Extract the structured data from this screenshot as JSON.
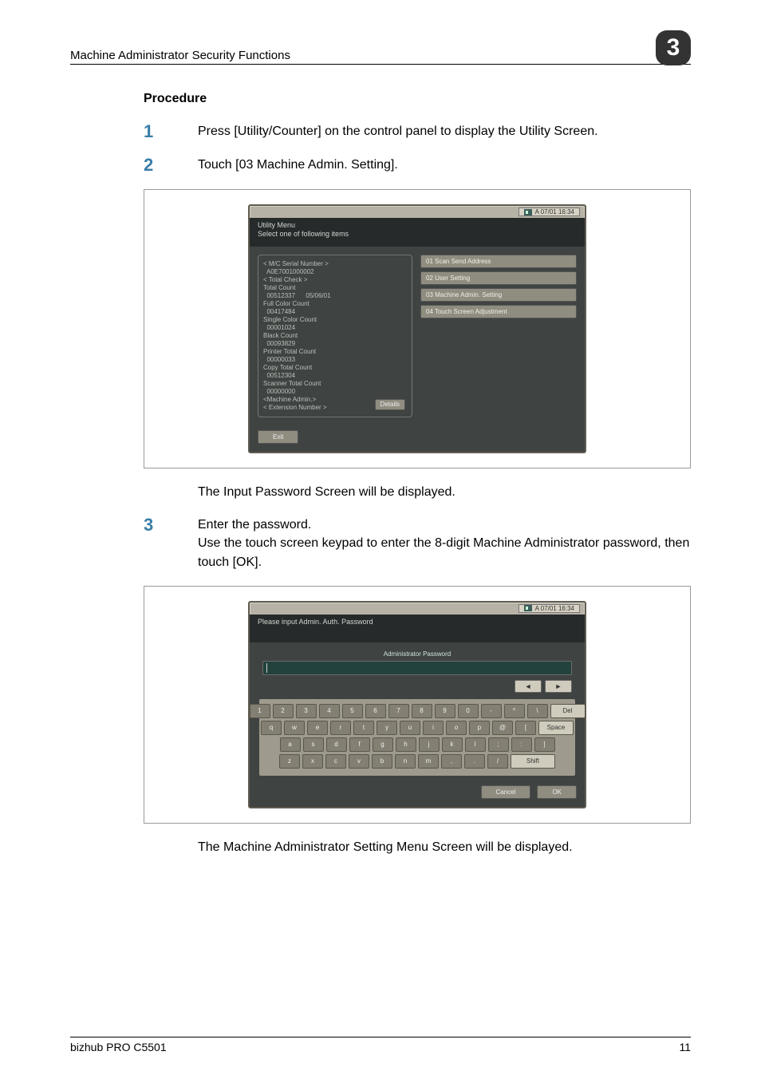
{
  "header": {
    "title": "Machine Administrator Security Functions",
    "chapter": "3"
  },
  "procedure_heading": "Procedure",
  "steps": {
    "s1": {
      "num": "1",
      "text": "Press [Utility/Counter] on the control panel to display the Utility Screen."
    },
    "s2": {
      "num": "2",
      "text": "Touch [03 Machine Admin. Setting]."
    },
    "s3": {
      "num": "3",
      "line1": "Enter the password.",
      "line2": "Use the touch screen keypad to enter the 8-digit Machine Administrator password, then touch [OK]."
    }
  },
  "after_screen1": "The Input Password Screen will be displayed.",
  "after_screen2": "The Machine Administrator Setting Menu Screen will be displayed.",
  "screen1": {
    "memory": "A 07/01 16:34",
    "title_l1": "Utility Menu",
    "title_l2": "Select one of following items",
    "stats_lines": [
      "< M/C Serial Number >",
      "  A0E7001000002",
      "< Total Check >",
      "Total Count",
      "  00512337      05/06/01",
      "Full Color Count",
      "  00417484",
      "Single Color Count",
      "  00001024",
      "Black Count",
      "  00093829",
      "Printer Total Count",
      "  00000033",
      "Copy Total Count",
      "  00512304",
      "Scanner Total Count",
      "  00000000",
      "<Machine Admin.>",
      "",
      "< Extension Number >",
      "  -----"
    ],
    "details_btn": "Details",
    "menu": [
      "01 Scan Send Address",
      "02 User Setting",
      "03 Machine Admin. Setting",
      "04 Touch Screen Adjustment"
    ],
    "exit_btn": "Exit"
  },
  "screen2": {
    "memory": "A 07/01 16:34",
    "title": "Please input Admin. Auth. Password",
    "field_label": "Administrator Password",
    "arrows": {
      "left": "◄",
      "right": "►"
    },
    "keys_r1": [
      "1",
      "2",
      "3",
      "4",
      "5",
      "6",
      "7",
      "8",
      "9",
      "0",
      "-",
      "^",
      "\\"
    ],
    "key_del": "Del",
    "keys_r2": [
      "q",
      "w",
      "e",
      "r",
      "t",
      "y",
      "u",
      "i",
      "o",
      "p",
      "@",
      "["
    ],
    "key_space": "Space",
    "keys_r3": [
      "a",
      "s",
      "d",
      "f",
      "g",
      "h",
      "j",
      "k",
      "l",
      ";",
      ":",
      "]"
    ],
    "keys_r4": [
      "z",
      "x",
      "c",
      "v",
      "b",
      "n",
      "m",
      ",",
      ".",
      "/"
    ],
    "key_shift": "Shift",
    "cancel_btn": "Cancel",
    "ok_btn": "OK"
  },
  "footer": {
    "product": "bizhub PRO C5501",
    "page": "11"
  }
}
